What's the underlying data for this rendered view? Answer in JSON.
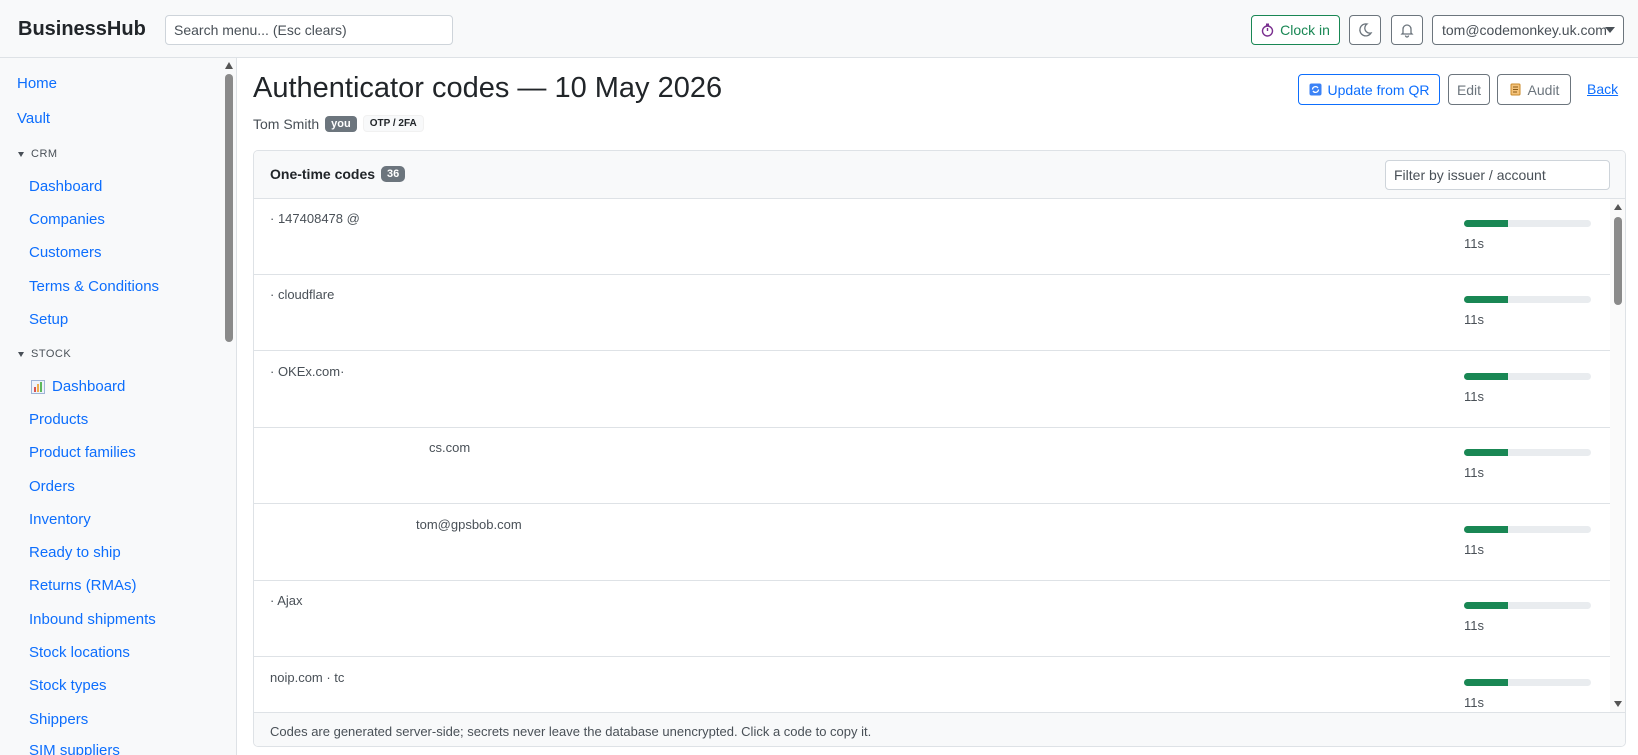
{
  "navbar": {
    "brand": "BusinessHub",
    "search_placeholder": "Search menu... (Esc clears)",
    "clock_in_label": "Clock in",
    "user_email": "tom@codemonkey.uk.com"
  },
  "sidebar": {
    "top_links": [
      "Home",
      "Vault"
    ],
    "crm": {
      "title": "CRM",
      "items": [
        "Dashboard",
        "Companies",
        "Customers",
        "Terms & Conditions",
        "Setup"
      ]
    },
    "stock": {
      "title": "STOCK",
      "items": [
        "Dashboard",
        "Products",
        "Product families",
        "Orders",
        "Inventory",
        "Ready to ship",
        "Returns (RMAs)",
        "Inbound shipments",
        "Stock locations",
        "Stock types",
        "Shippers",
        "SIM suppliers"
      ]
    }
  },
  "page": {
    "title": "Authenticator codes — 10 May 2026",
    "owner": "Tom Smith",
    "you_badge": "you",
    "type_badge": "OTP / 2FA",
    "update_qr_label": "Update from QR",
    "edit_label": "Edit",
    "audit_label": "Audit",
    "back_label": "Back"
  },
  "codes": {
    "title": "One-time codes",
    "count": "36",
    "filter_placeholder": "Filter by issuer / account",
    "footer": "Codes are generated server-side; secrets never leave the database unencrypted. Click a code to copy it.",
    "rows": [
      {
        "label": "· 147408478 @",
        "remaining": "11s",
        "progress": 0.35
      },
      {
        "label": "· cloudflare",
        "remaining": "11s",
        "progress": 0.35
      },
      {
        "label": "· OKEx.com·",
        "remaining": "11s",
        "progress": 0.35
      },
      {
        "label": "cs.com",
        "remaining": "11s",
        "progress": 0.35
      },
      {
        "label": "tom@gpsbob.com",
        "remaining": "11s",
        "progress": 0.35
      },
      {
        "label": "· Ajax",
        "remaining": "11s",
        "progress": 0.35
      },
      {
        "label": "noip.com · tc",
        "remaining": "11s",
        "progress": 0.35
      }
    ]
  },
  "colors": {
    "link": "#0d6efd",
    "success": "#198754",
    "secondary": "#6c757d"
  }
}
